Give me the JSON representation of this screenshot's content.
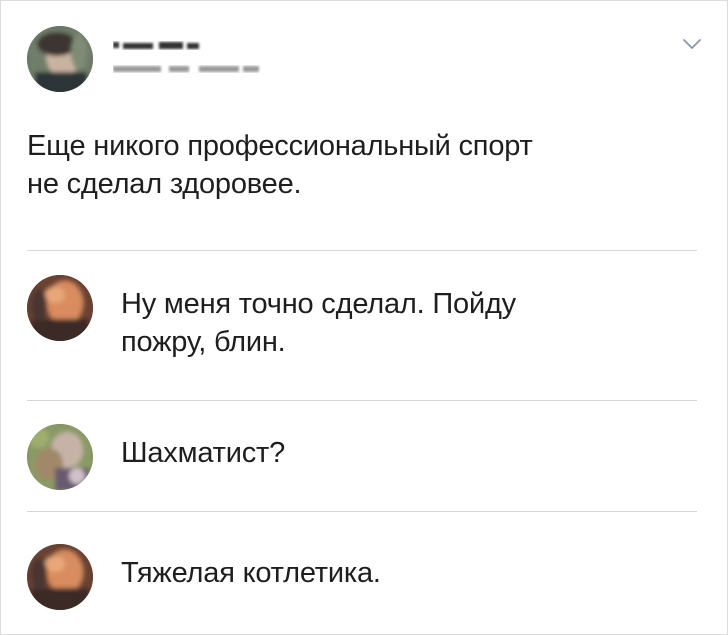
{
  "post": {
    "author_name": "",
    "author_meta": "",
    "text_line_1": "Еще никого профессиональный спорт",
    "text_line_2": "не сделал здоровее."
  },
  "comments": [
    {
      "text_line_1": "Ну меня точно сделал. Пойду",
      "text_line_2": "пожру, блин."
    },
    {
      "text_line_1": "Шахматист?",
      "text_line_2": ""
    },
    {
      "text_line_1": "Тяжелая котлетика.",
      "text_line_2": ""
    }
  ],
  "colors": {
    "text": "#1e1e1e",
    "divider": "#d6d6d6",
    "chevron": "#8a98a8",
    "border": "#dcdcdc"
  },
  "icons": {
    "menu": "chevron-down-icon"
  }
}
